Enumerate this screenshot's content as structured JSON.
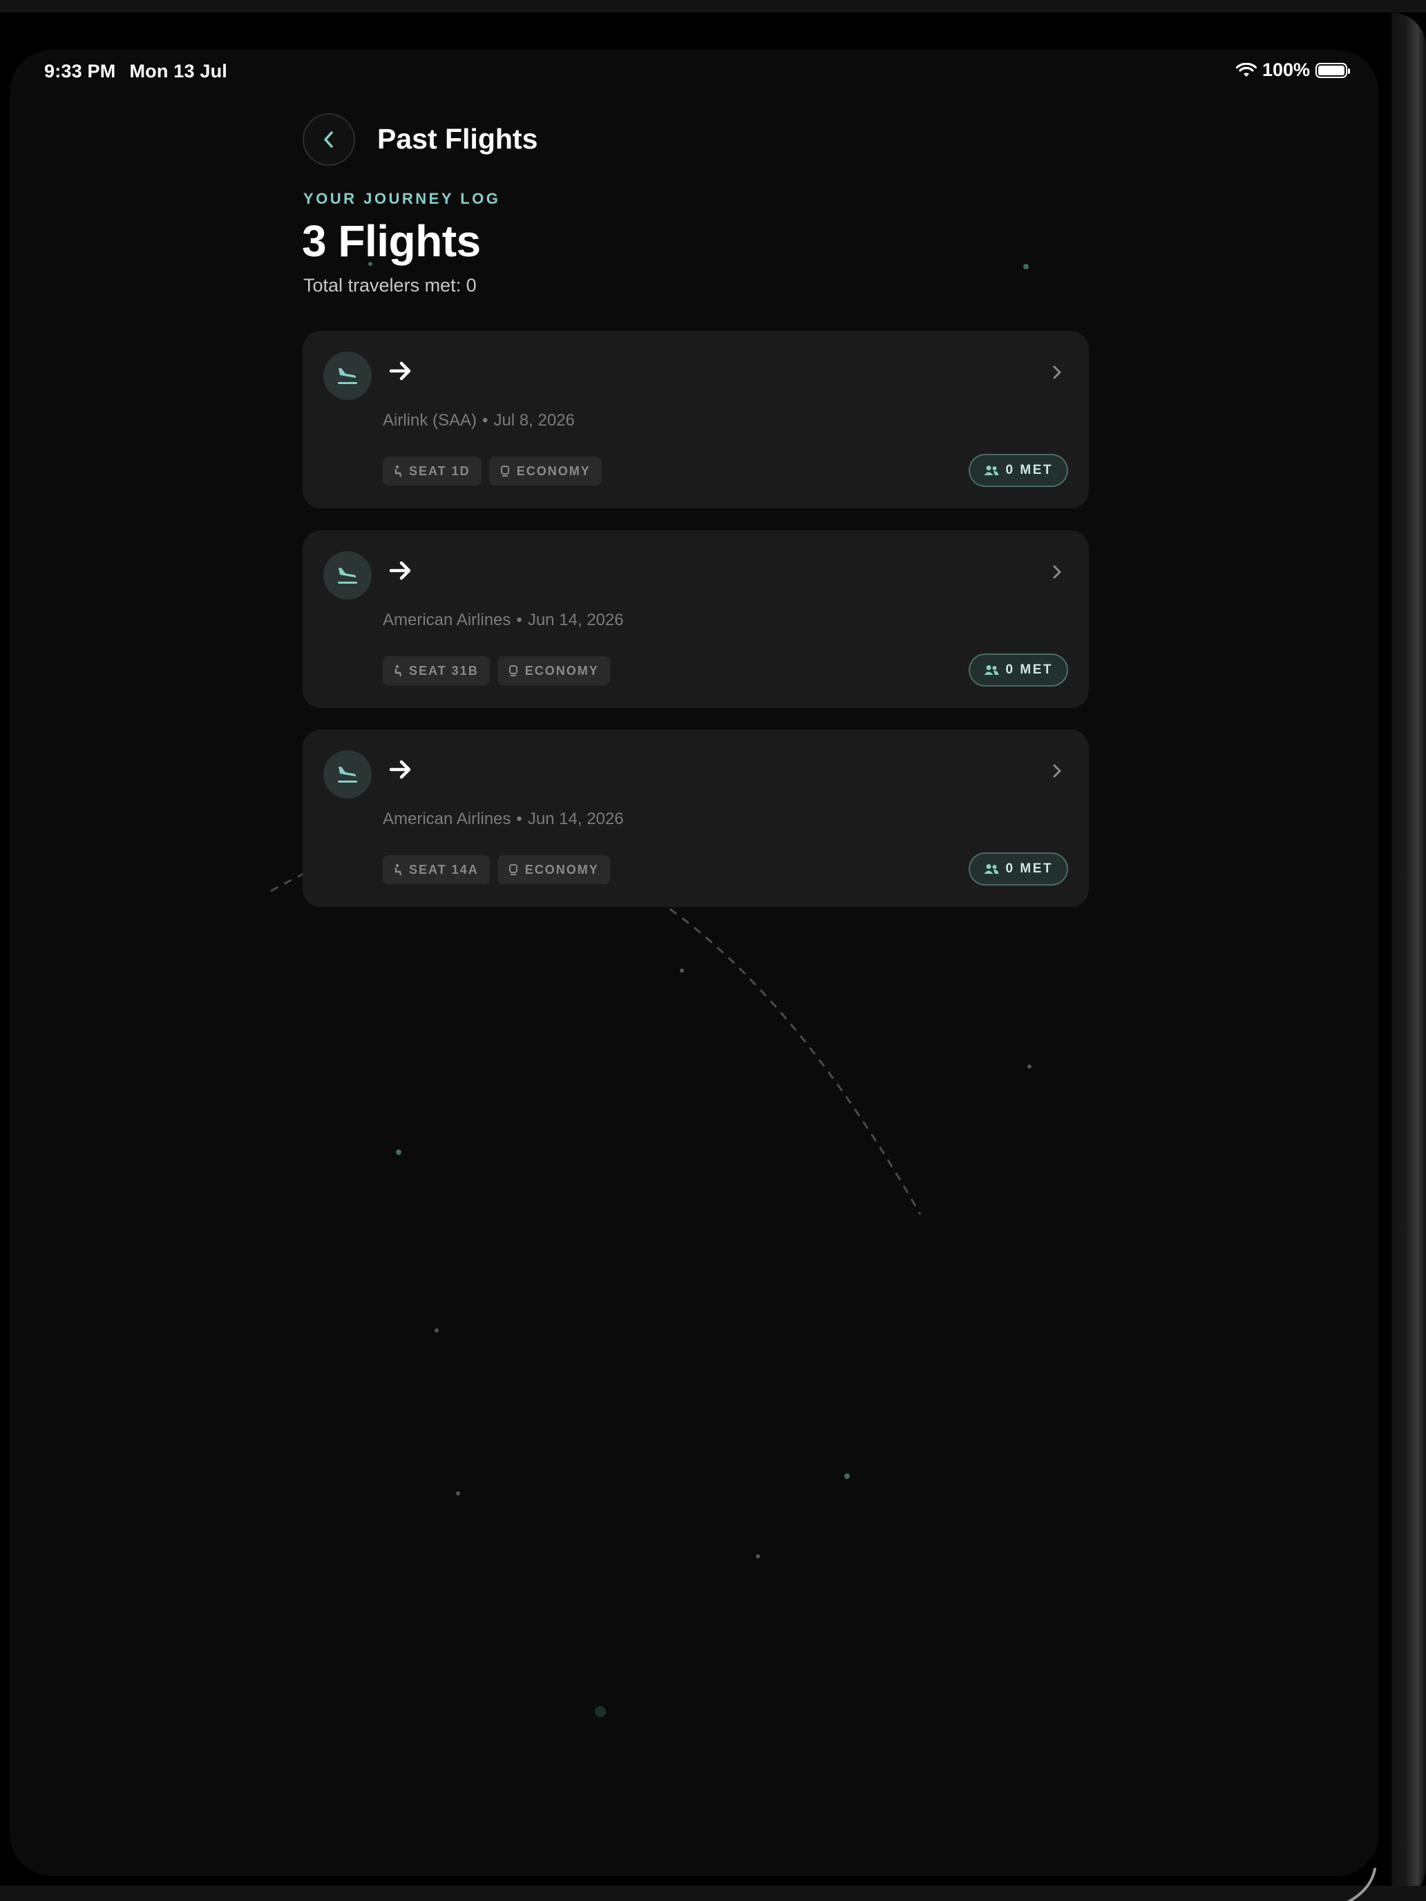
{
  "status_bar": {
    "time": "9:33 PM",
    "date": "Mon 13 Jul",
    "battery": "100%"
  },
  "header": {
    "title": "Past Flights",
    "eyebrow": "YOUR JOURNEY LOG",
    "count": "3 Flights",
    "subtitle": "Total travelers met: 0"
  },
  "colors": {
    "accent": "#86d0c6",
    "card_bg": "#1b1b1b",
    "background": "#0b0b0b"
  },
  "icons": {
    "back": "chevron-left-icon",
    "plane": "flight-land-icon",
    "arrow": "arrow-right-icon",
    "seat": "seat-icon",
    "class": "class-icon",
    "people": "people-icon"
  },
  "flights": [
    {
      "airline": "Airlink (SAA)",
      "separator": "•",
      "date": "Jul 8, 2026",
      "seat": "SEAT 1D",
      "cabin": "ECONOMY",
      "met": "0 MET"
    },
    {
      "airline": "American Airlines",
      "separator": "•",
      "date": "Jun 14, 2026",
      "seat": "SEAT 31B",
      "cabin": "ECONOMY",
      "met": "0 MET"
    },
    {
      "airline": "American Airlines",
      "separator": "•",
      "date": "Jun 14, 2026",
      "seat": "SEAT 14A",
      "cabin": "ECONOMY",
      "met": "0 MET"
    }
  ]
}
